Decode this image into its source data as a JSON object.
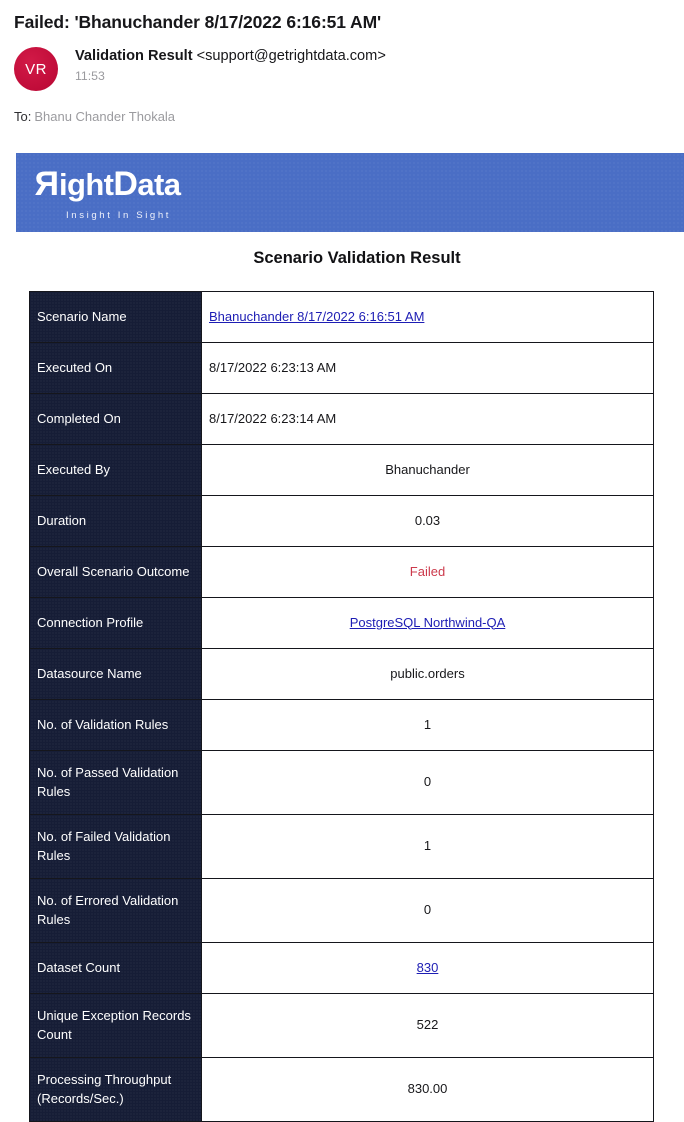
{
  "email": {
    "subject": "Failed: 'Bhanuchander 8/17/2022 6:16:51 AM'",
    "sender_name": "Validation Result",
    "sender_email": "<support@getrightdata.com>",
    "time": "11:53",
    "to_label": "To:",
    "to_value": "Bhanu Chander Thokala",
    "avatar_initials": "VR",
    "avatar_color": "#c8103c"
  },
  "banner": {
    "logo_r": "R",
    "logo_ight": "ight",
    "logo_d": "D",
    "logo_ata": "ata",
    "tagline": "Insight In Sight",
    "background_color": "#4a6ec5"
  },
  "report": {
    "title": "Scenario Validation Result",
    "failed_color": "#cc3a4c",
    "link_color": "#1d1db4",
    "header_cell_color": "#161d36",
    "rows": [
      {
        "label": "Scenario Name",
        "value": "Bhanuchander 8/17/2022 6:16:51 AM",
        "style": "link-left"
      },
      {
        "label": "Executed On",
        "value": "8/17/2022 6:23:13 AM",
        "style": "left"
      },
      {
        "label": "Completed On",
        "value": "8/17/2022 6:23:14 AM",
        "style": "left"
      },
      {
        "label": "Executed By",
        "value": "Bhanuchander",
        "style": "center"
      },
      {
        "label": "Duration",
        "value": "0.03",
        "style": "center"
      },
      {
        "label": "Overall Scenario Outcome",
        "value": "Failed",
        "style": "failed"
      },
      {
        "label": "Connection Profile",
        "value": "PostgreSQL Northwind-QA",
        "style": "link-center"
      },
      {
        "label": "Datasource Name",
        "value": "public.orders",
        "style": "center"
      },
      {
        "label": "No. of Validation Rules",
        "value": "1",
        "style": "center"
      },
      {
        "label": "No. of Passed Validation Rules",
        "value": "0",
        "style": "center"
      },
      {
        "label": "No. of Failed Validation Rules",
        "value": "1",
        "style": "center"
      },
      {
        "label": "No. of Errored Validation Rules",
        "value": "0",
        "style": "center"
      },
      {
        "label": "Dataset Count",
        "value": "830",
        "style": "link-center"
      },
      {
        "label": "Unique Exception Records Count",
        "value": "522",
        "style": "center"
      },
      {
        "label": "Processing Throughput (Records/Sec.)",
        "value": "830.00",
        "style": "center"
      }
    ]
  }
}
